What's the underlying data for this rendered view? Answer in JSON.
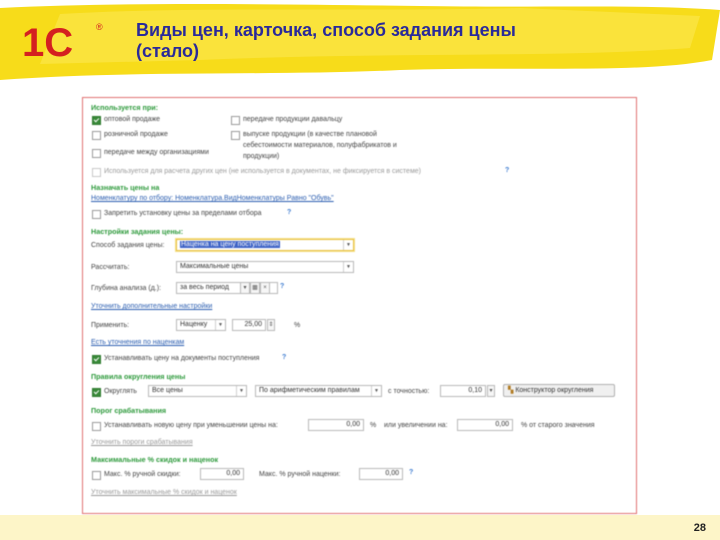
{
  "header": {
    "title": "Виды цен, карточка, способ задания цены (стало)",
    "brand_color": "#f5d400",
    "title_color": "#2a2a9a"
  },
  "logo": {
    "text": "1С",
    "mark": "®"
  },
  "page_number": "28",
  "form": {
    "used_in": {
      "heading": "Используется при:",
      "wholesale": "оптовой продаже",
      "retail": "розничной продаже",
      "transfer": "передаче между организациями",
      "giver_transfer": "передаче продукции давальцу",
      "production_line1": "выпуске продукции (в качестве плановой",
      "production_line2": "себестоимости материалов, полуфабрикатов и",
      "production_line3": "продукции)",
      "other_prices": "Используется для расчета других цен (не используется в документах, не фиксируется в системе)"
    },
    "assign": {
      "heading": "Назначать цены на",
      "filter_link": "Номенклатуру по отбору: Номенклатура.ВидНоменклатуры Равно \"Обувь\"",
      "forbid": "Запретить установку цены за пределами отбора"
    },
    "settings": {
      "heading": "Настройки задания цены:",
      "method_label": "Способ задания цены:",
      "method_value": "Наценка на цену поступления",
      "calc_label": "Рассчитать:",
      "calc_value": "Максимальные цены",
      "depth_label": "Глубина анализа (д.):",
      "depth_value": "за весь период",
      "more_link": "Уточнить дополнительные настройки",
      "apply_label": "Применить:",
      "apply_value": "Наценку",
      "apply_number": "25,00",
      "apply_unit": "%",
      "markup_link": "Есть уточнения по наценкам",
      "set_on_receipt": "Устанавливать цену на документы поступления"
    },
    "rounding": {
      "heading": "Правила округления цены",
      "round_label": "Округлять",
      "all_prices": "Все цены",
      "rule": "По арифметическим правилам",
      "precision_label": "с точностью:",
      "precision_value": "0,10",
      "constructor": "Конструктор округления"
    },
    "threshold": {
      "heading": "Порог срабатывания",
      "set_new_price": "Устанавливать новую цену при уменьшении цены на:",
      "decrease_value": "0,00",
      "pct1": "%",
      "or_increase": "или увеличении на:",
      "increase_value": "0,00",
      "from_old": "% от старого значения",
      "link": "Уточнить пороги срабатывания"
    },
    "max_pct": {
      "heading": "Максимальные % скидок и наценок",
      "max_discount_label": "Макс. % ручной скидки:",
      "max_discount_value": "0,00",
      "max_markup_label": "Макс. % ручной наценки:",
      "max_markup_value": "0,00",
      "link": "Уточнить максимальные % скидок и наценок"
    },
    "help_mark": "?",
    "dropdown_glyph": "▼"
  }
}
